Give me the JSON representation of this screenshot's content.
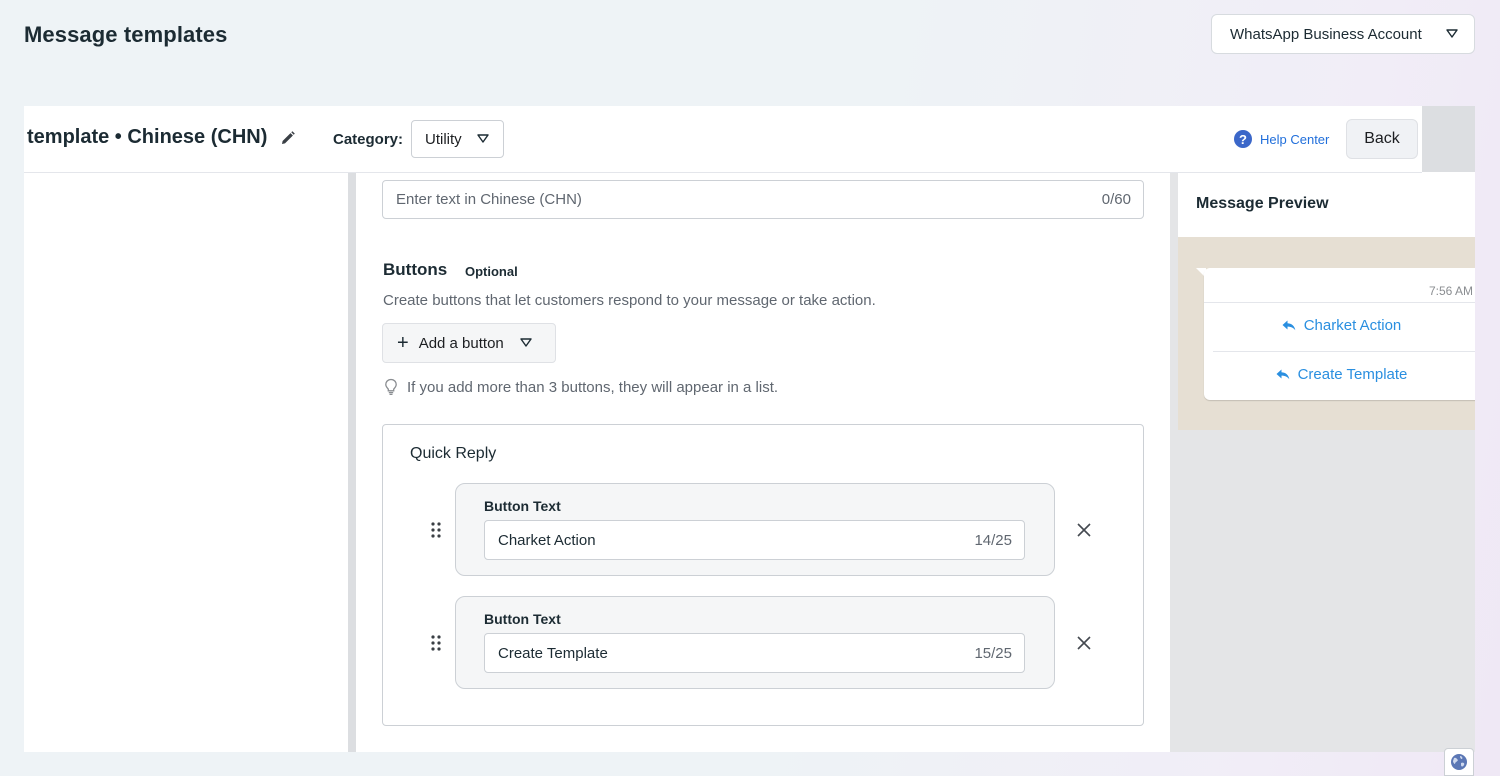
{
  "header": {
    "title": "Message templates",
    "account_select": "WhatsApp Business Account"
  },
  "toolbar": {
    "template_name": "template • Chinese (CHN)",
    "category_label": "Category",
    "category_value": "Utility",
    "help_center": "Help Center",
    "back": "Back"
  },
  "footer_field": {
    "placeholder": "Enter text in Chinese (CHN)",
    "counter": "0/60"
  },
  "buttons_section": {
    "title": "Buttons",
    "optional": "Optional",
    "description": "Create buttons that let customers respond to your message or take action.",
    "add_button": "Add a button",
    "hint": "If you add more than 3 buttons, they will appear in a list."
  },
  "quick_reply": {
    "title": "Quick Reply",
    "items": [
      {
        "label": "Button Text",
        "value": "Charket Action",
        "counter": "14/25"
      },
      {
        "label": "Button Text",
        "value": "Create Template",
        "counter": "15/25"
      }
    ]
  },
  "preview": {
    "title": "Message Preview",
    "time": "7:56 AM",
    "buttons": [
      "Charket Action",
      "Create Template"
    ]
  },
  "colors": {
    "link_blue": "#216fdb",
    "preview_button": "#2a8fe0",
    "chat_bg": "#e6dfd3"
  }
}
